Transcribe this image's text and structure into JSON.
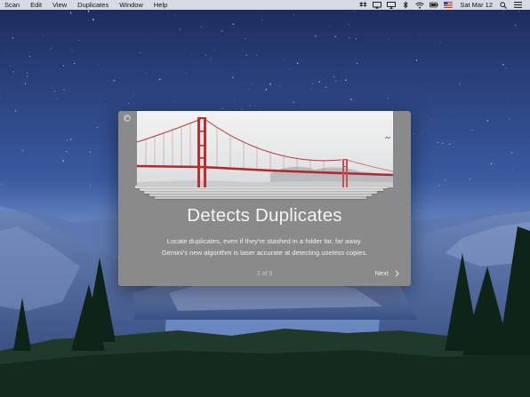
{
  "menubar": {
    "items": [
      "Scan",
      "Edit",
      "View",
      "Duplicates",
      "Window",
      "Help"
    ],
    "clock": "Sat Mar 12",
    "status_icons": [
      "dropbox-icon",
      "screen-icon",
      "airplay-icon",
      "bluetooth-icon",
      "wifi-icon",
      "battery-icon",
      "us-flag-icon",
      "search-icon",
      "list-icon"
    ]
  },
  "onboarding": {
    "title": "Detects Duplicates",
    "description_line1": "Locate duplicates, even if they're stashed in a folder far, far away.",
    "description_line2": "Gemini's new algorithm is laser accurate at detecting useless copies.",
    "pager": "2 of 5",
    "next_label": "Next"
  },
  "colors": {
    "window_bg": "#8a8a8a",
    "bridge": "#c42f2f",
    "sky_top": "#1e2d63",
    "sky_bottom": "#7b98d1"
  }
}
